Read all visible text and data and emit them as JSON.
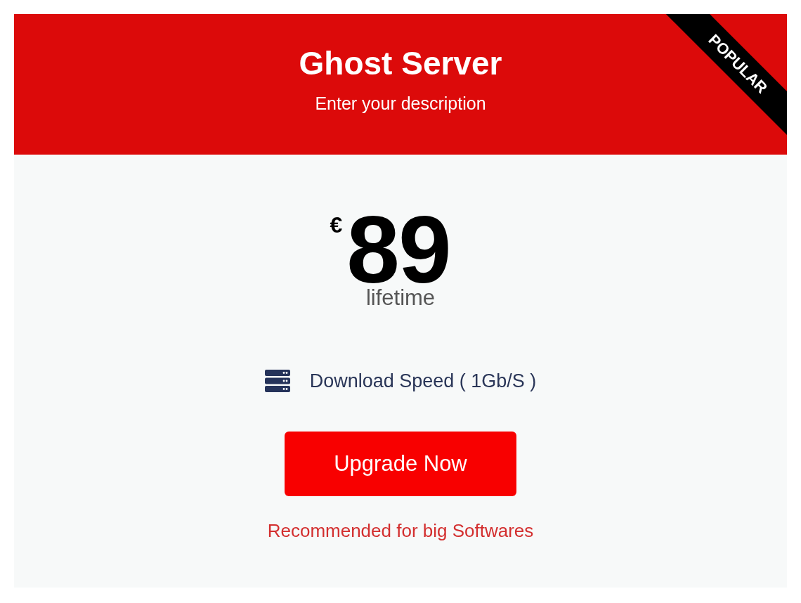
{
  "header": {
    "title": "Ghost Server",
    "description": "Enter your description"
  },
  "ribbon": {
    "label": "POPULAR"
  },
  "price": {
    "currency": "€",
    "amount": "89",
    "period": "lifetime"
  },
  "features": [
    {
      "text": "Download Speed ( 1Gb/S )"
    }
  ],
  "button": {
    "label": "Upgrade Now"
  },
  "note": "Recommended for big Softwares"
}
